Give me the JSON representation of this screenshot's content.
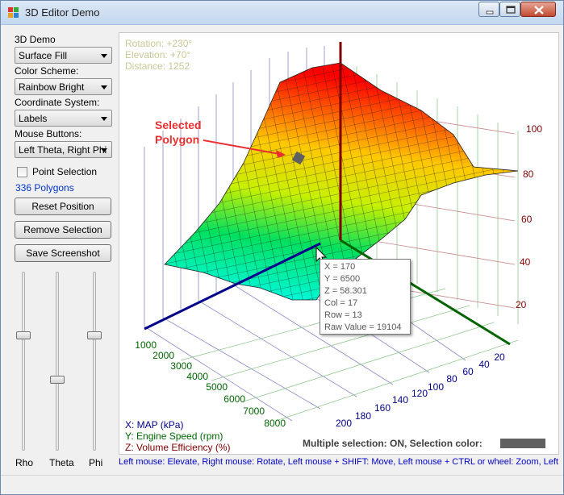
{
  "window": {
    "title": "3D Editor Demo"
  },
  "sidebar": {
    "demo_label": "3D Demo",
    "demo_value": "Surface Fill",
    "color_label": "Color Scheme:",
    "color_value": "Rainbow Bright",
    "coord_label": "Coordinate System:",
    "coord_value": "Labels",
    "mouse_label": "Mouse Buttons:",
    "mouse_value": "Left Theta, Right Phi",
    "point_selection": "Point Selection",
    "polygon_count": "336 Polygons",
    "reset_button": "Reset Position",
    "remove_button": "Remove Selection",
    "save_button": "Save Screenshot",
    "sliders": [
      {
        "label": "Rho",
        "value": 0.63
      },
      {
        "label": "Theta",
        "value": 0.38
      },
      {
        "label": "Phi",
        "value": 0.63
      }
    ]
  },
  "plot": {
    "rotation": "Rotation:  +230°",
    "elevation": "Elevation: +70°",
    "distance": "Distance:  1252",
    "annotation_line1": "Selected",
    "annotation_line2": "Polygon",
    "x_ticks": [
      "1000",
      "2000",
      "3000",
      "4000",
      "5000",
      "6000",
      "7000",
      "8000"
    ],
    "y_ticks": [
      "20",
      "40",
      "60",
      "80",
      "100",
      "120",
      "140",
      "160",
      "180",
      "200"
    ],
    "z_ticks": [
      "20",
      "40",
      "60",
      "80",
      "100"
    ],
    "legend_x": "X: MAP (kPa)",
    "legend_y": "Y: Engine Speed (rpm)",
    "legend_z": "Z: Volume Efficiency (%)",
    "selection_status": "Multiple selection: ON, Selection color:",
    "colors": {
      "selection": "#606060",
      "x_axis": "#00008b",
      "y_axis": "#006400",
      "z_axis": "#800000",
      "annotation": "#e83030"
    }
  },
  "tooltip": {
    "x": "X = 170",
    "y": "Y = 6500",
    "z": "Z = 58.301",
    "col": "Col = 17",
    "row": "Row = 13",
    "raw": "Raw Value = 19104"
  },
  "statusbar": {
    "hint": "Left mouse: Elevate,  Right mouse: Rotate,  Left mouse + SHIFT: Move,  Left mouse + CTRL or wheel: Zoom, Left mouse + ALT: Select"
  }
}
